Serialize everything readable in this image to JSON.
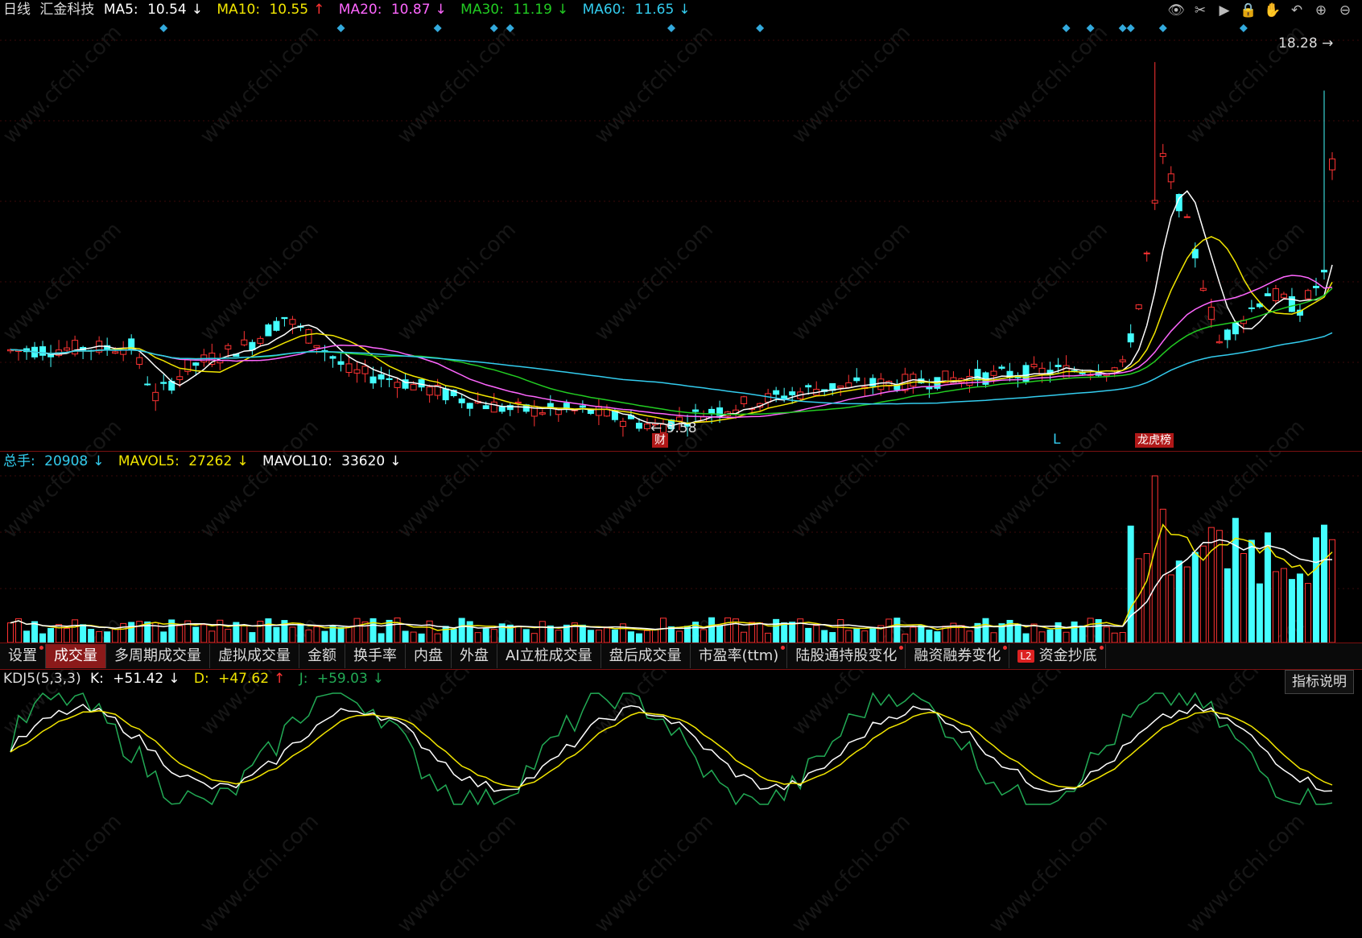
{
  "main_header": {
    "period": "日线",
    "stock_name": "汇金科技",
    "ma5": {
      "label": "MA5:",
      "value": "10.54",
      "arrow": "↓",
      "color": "#ffffff"
    },
    "ma10": {
      "label": "MA10:",
      "value": "10.55",
      "arrow": "↑",
      "color": "#f2e600"
    },
    "ma20": {
      "label": "MA20:",
      "value": "10.87",
      "arrow": "↓",
      "color": "#ff66ff"
    },
    "ma30": {
      "label": "MA30:",
      "value": "11.19",
      "arrow": "↓",
      "color": "#22cc22"
    },
    "ma60": {
      "label": "MA60:",
      "value": "11.65",
      "arrow": "↓",
      "color": "#33ccee"
    }
  },
  "toolbar_icons": [
    "eye-icon",
    "scissors-icon",
    "play-icon",
    "lock-icon",
    "hand-icon",
    "undo-icon",
    "zoom-in-icon",
    "zoom-out-icon"
  ],
  "price_labels": {
    "high": "18.28",
    "low": "9.58"
  },
  "event_markers": {
    "cai": "财",
    "L": "L",
    "longhu": "龙虎榜"
  },
  "volume_header": {
    "total": {
      "label": "总手:",
      "value": "20908",
      "arrow": "↓",
      "color": "#33ccee"
    },
    "mavol5": {
      "label": "MAVOL5:",
      "value": "27262",
      "arrow": "↓",
      "color": "#f2e600"
    },
    "mavol10": {
      "label": "MAVOL10:",
      "value": "33620",
      "arrow": "↓",
      "color": "#ffffff"
    }
  },
  "tabs": [
    {
      "label": "设置",
      "dot": true
    },
    {
      "label": "成交量",
      "active": true
    },
    {
      "label": "多周期成交量"
    },
    {
      "label": "虚拟成交量"
    },
    {
      "label": "金额"
    },
    {
      "label": "换手率"
    },
    {
      "label": "内盘"
    },
    {
      "label": "外盘"
    },
    {
      "label": "AI立桩成交量"
    },
    {
      "label": "盘后成交量"
    },
    {
      "label": "市盈率(ttm)",
      "dot": true
    },
    {
      "label": "陆股通持股变化",
      "dot": true
    },
    {
      "label": "融资融券变化",
      "dot": true
    },
    {
      "label": "资金抄底",
      "dot": true,
      "badge": "L2"
    }
  ],
  "kdj_header": {
    "name": "KDJ5(5,3,3)",
    "k": {
      "label": "K:",
      "value": "+51.42",
      "arrow": "↓",
      "color": "#ffffff"
    },
    "d": {
      "label": "D:",
      "value": "+47.62",
      "arrow": "↑",
      "color": "#f2e600"
    },
    "j": {
      "label": "J:",
      "value": "+59.03",
      "arrow": "↓",
      "color": "#22aa55"
    }
  },
  "help_button": "指标说明",
  "watermark": "www.cfchi.com",
  "colors": {
    "up": "#ff3333",
    "down": "#44ffff",
    "grid": "#3a0a0a",
    "border": "#7a1010"
  }
}
